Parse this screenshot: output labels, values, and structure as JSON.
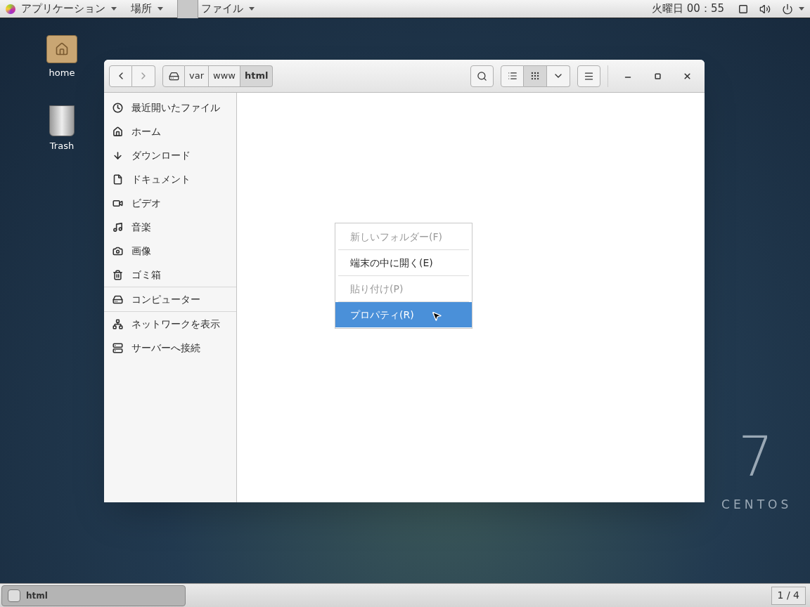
{
  "top_bar": {
    "menus": [
      {
        "label": "アプリケーション"
      },
      {
        "label": "場所"
      },
      {
        "label": "ファイル"
      }
    ],
    "clock": "火曜日 00：55"
  },
  "desktop_icons": [
    {
      "label": "home"
    },
    {
      "label": "Trash"
    }
  ],
  "window": {
    "path_bar": [
      {
        "label": "var",
        "selected": false
      },
      {
        "label": "www",
        "selected": false
      },
      {
        "label": "html",
        "selected": true
      }
    ],
    "views": [
      {
        "kind": "list",
        "selected": false
      },
      {
        "kind": "grid",
        "selected": true
      }
    ],
    "sidebar": {
      "groups": [
        [
          {
            "label": "最近開いたファイル"
          },
          {
            "label": "ホーム"
          },
          {
            "label": "ダウンロード"
          },
          {
            "label": "ドキュメント"
          },
          {
            "label": "ビデオ"
          },
          {
            "label": "音楽"
          },
          {
            "label": "画像"
          },
          {
            "label": "ゴミ箱"
          }
        ],
        [
          {
            "label": "コンピューター"
          }
        ],
        [
          {
            "label": "ネットワークを表示"
          },
          {
            "label": "サーバーへ接続"
          }
        ]
      ]
    }
  },
  "context_menu": [
    {
      "label": "新しいフォルダー(F)",
      "disabled": true,
      "selected": false
    },
    {
      "label": "端末の中に開く(E)",
      "disabled": false,
      "selected": false
    },
    {
      "label": "貼り付け(P)",
      "disabled": true,
      "selected": false
    },
    {
      "label": "プロパティ(R)",
      "disabled": false,
      "selected": true
    }
  ],
  "branding": {
    "number": "7",
    "name": "CENTOS"
  },
  "taskbar": {
    "task": "html",
    "workspace": "1 / 4"
  }
}
